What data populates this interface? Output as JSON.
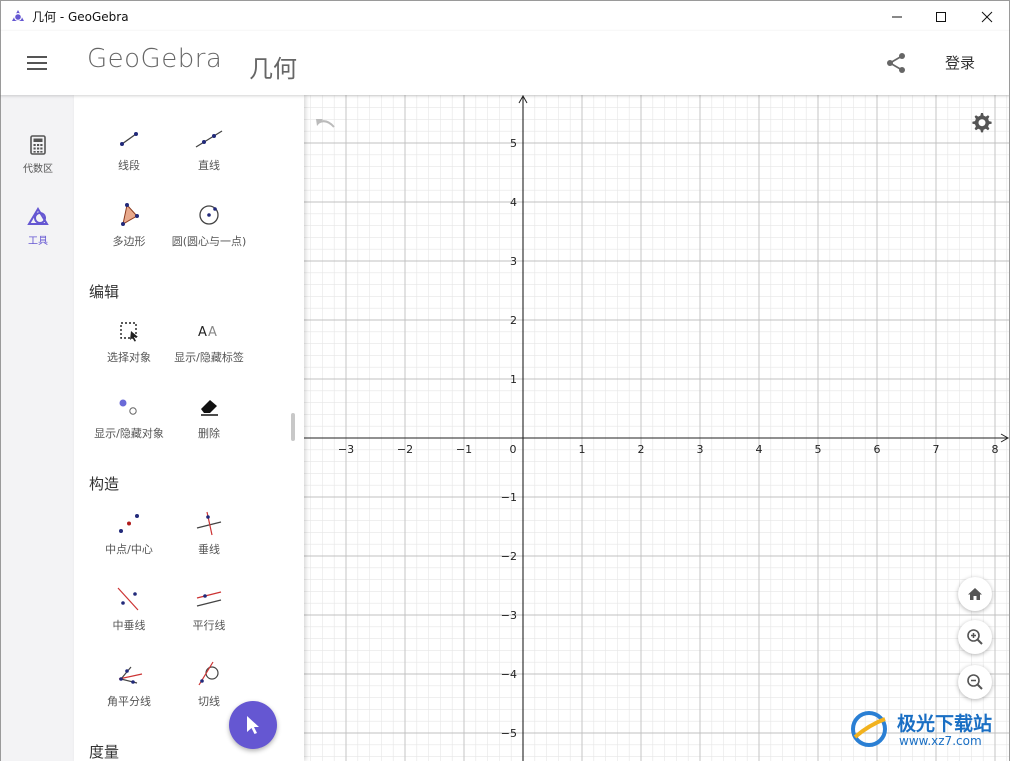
{
  "window": {
    "title": "几何 - GeoGebra",
    "minimize_icon": "minimize-icon",
    "maximize_icon": "maximize-icon",
    "close_icon": "close-icon"
  },
  "header": {
    "logo_text": "GeoGebra",
    "app_name": "几何",
    "login_label": "登录"
  },
  "rail": {
    "items": [
      {
        "label": "代数区",
        "icon": "calculator-icon"
      },
      {
        "label": "工具",
        "icon": "shapes-icon",
        "active": true
      }
    ]
  },
  "tools": {
    "basic": [
      {
        "label": "线段",
        "icon": "segment-icon"
      },
      {
        "label": "直线",
        "icon": "line-icon"
      },
      {
        "label": "多边形",
        "icon": "polygon-icon"
      },
      {
        "label": "圆(圆心与一点)",
        "icon": "circle-center-point-icon"
      }
    ],
    "edit_title": "编辑",
    "edit": [
      {
        "label": "选择对象",
        "icon": "select-objects-icon"
      },
      {
        "label": "显示/隐藏标签",
        "icon": "show-hide-label-icon"
      },
      {
        "label": "显示/隐藏对象",
        "icon": "show-hide-object-icon"
      },
      {
        "label": "删除",
        "icon": "delete-icon"
      }
    ],
    "construct_title": "构造",
    "construct": [
      {
        "label": "中点/中心",
        "icon": "midpoint-icon"
      },
      {
        "label": "垂线",
        "icon": "perpendicular-line-icon"
      },
      {
        "label": "中垂线",
        "icon": "perpendicular-bisector-icon"
      },
      {
        "label": "平行线",
        "icon": "parallel-line-icon"
      },
      {
        "label": "角平分线",
        "icon": "angle-bisector-icon"
      },
      {
        "label": "切线",
        "icon": "tangent-icon"
      }
    ],
    "measure_title": "度量"
  },
  "graphics": {
    "x_ticks": [
      "−3",
      "−2",
      "−1",
      "0",
      "1",
      "2",
      "3",
      "4",
      "5",
      "6",
      "7",
      "8"
    ],
    "y_ticks_pos": [
      "5",
      "4",
      "3",
      "2",
      "1"
    ],
    "y_ticks_neg": [
      "−1",
      "−2",
      "−3",
      "−4",
      "−5"
    ],
    "x_range": [
      -3.6,
      8.3
    ],
    "y_range": [
      -5.3,
      5.8
    ],
    "grid": true
  },
  "watermark": {
    "text": "极光下载站",
    "url": "www.xz7.com"
  },
  "colors": {
    "accent": "#6557d2",
    "axis": "#222222",
    "grid_major": "#c0c0c0",
    "grid_minor": "#e6e6e6",
    "rail_bg": "#f3f3f5"
  }
}
